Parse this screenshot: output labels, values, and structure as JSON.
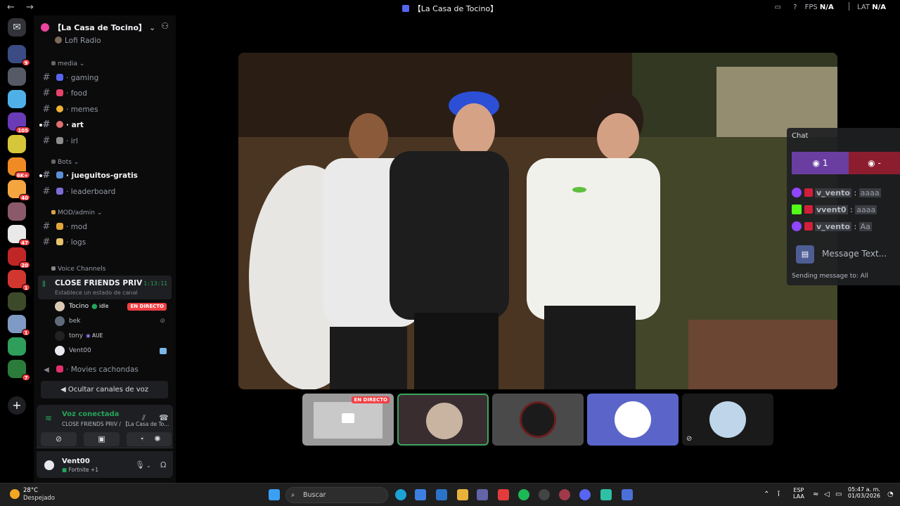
{
  "titlebar": {
    "back": "←",
    "forward": "→",
    "title": "【La Casa de Tocino】",
    "fps_label": "FPS",
    "fps_value": "N/A",
    "lat_label": "LAT",
    "lat_value": "N/A"
  },
  "server": {
    "name": "【La Casa de Tocino】"
  },
  "guild_badges": [
    "9",
    "",
    "",
    "105",
    "",
    "6K+",
    "40",
    "",
    "47",
    "20",
    "1",
    "",
    "1",
    "",
    "7"
  ],
  "channels": [
    {
      "label": "Lofi Radio",
      "type": "voice"
    },
    {
      "label": "media",
      "type": "category"
    },
    {
      "label": "gaming",
      "type": "text"
    },
    {
      "label": "food",
      "type": "text"
    },
    {
      "label": "memes",
      "type": "text"
    },
    {
      "label": "art",
      "type": "text",
      "unread": true
    },
    {
      "label": "irl",
      "type": "text"
    },
    {
      "label": "Bots",
      "type": "category"
    },
    {
      "label": "jueguitos-gratis",
      "type": "text",
      "unread": true
    },
    {
      "label": "leaderboard",
      "type": "text"
    },
    {
      "label": "MOD/admin",
      "type": "category"
    },
    {
      "label": "mod",
      "type": "text"
    },
    {
      "label": "logs",
      "type": "text"
    },
    {
      "label": "Voice Channels",
      "type": "category"
    }
  ],
  "voice_channel": {
    "name": "CLOSE FRIENDS PRIV",
    "status": "Establece un estado de canal",
    "time": "1:13:11",
    "users": [
      {
        "name": "Tocino",
        "tag": "idle",
        "live": "EN DIRECTO"
      },
      {
        "name": "bek",
        "tag": ""
      },
      {
        "name": "tony",
        "tag": "AUE"
      },
      {
        "name": "Vent00",
        "tag": ""
      }
    ],
    "next_channel": "Movies cachondas",
    "hide_button": "Ocultar canales de voz"
  },
  "voice_panel": {
    "connected": "Voz conectada",
    "location": "CLOSE FRIENDS PRIV / 【La Casa de To..."
  },
  "user": {
    "name": "Vent00",
    "activity": "Fortnite +1"
  },
  "stream": {
    "live_badge": "EN DIRECTO"
  },
  "chat": {
    "title": "Chat",
    "viewers": "1",
    "viewers2": "-",
    "messages": [
      {
        "user": "v_vento",
        "text": "aaaa",
        "platform": "twitch"
      },
      {
        "user": "vvent0",
        "text": "aaaa",
        "platform": "kick"
      },
      {
        "user": "v_vento",
        "text": "Aa",
        "platform": "twitch"
      }
    ],
    "placeholder": "Message Text...",
    "sending_to": "Sending message to: All"
  },
  "taskbar": {
    "temp": "28°C",
    "weather": "Despejado",
    "search": "Buscar",
    "lang1": "ESP",
    "lang2": "LAA",
    "time": "05:47 a. m.",
    "date": "01/03/2026"
  },
  "colors": {
    "accent": "#5865f2",
    "online": "#23a559",
    "live": "#f23f43",
    "twitch": "#9146ff",
    "kick": "#53fc18"
  }
}
